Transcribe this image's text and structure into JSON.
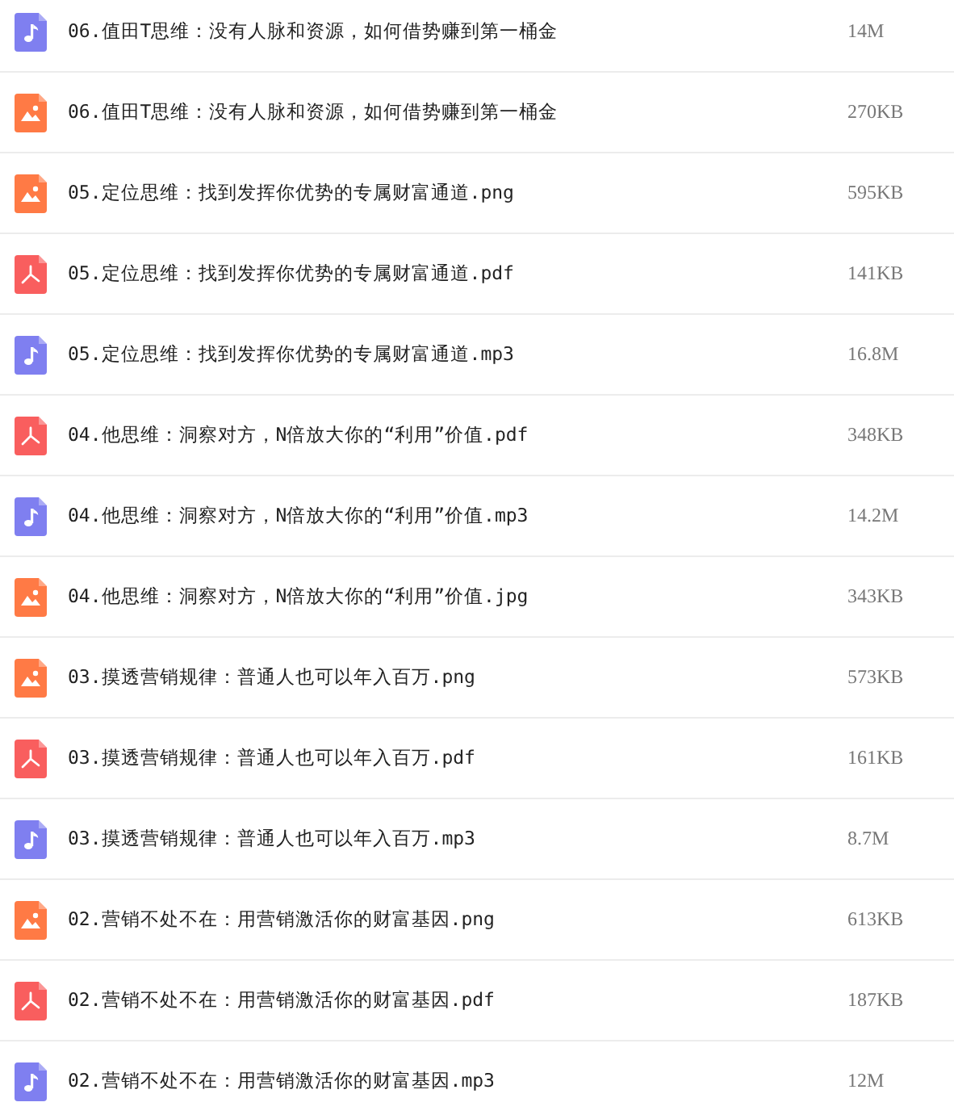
{
  "files": [
    {
      "kind": "audio",
      "name": "06.值田T思维：没有人脉和资源，如何借势赚到第一桶金",
      "size": "14M"
    },
    {
      "kind": "image",
      "name": "06.值田T思维：没有人脉和资源，如何借势赚到第一桶金",
      "size": "270KB"
    },
    {
      "kind": "image",
      "name": "05.定位思维：找到发挥你优势的专属财富通道.png",
      "size": "595KB"
    },
    {
      "kind": "pdf",
      "name": "05.定位思维：找到发挥你优势的专属财富通道.pdf",
      "size": "141KB"
    },
    {
      "kind": "audio",
      "name": "05.定位思维：找到发挥你优势的专属财富通道.mp3",
      "size": "16.8M"
    },
    {
      "kind": "pdf",
      "name": "04.他思维：洞察对方，N倍放大你的“利用”价值.pdf",
      "size": "348KB"
    },
    {
      "kind": "audio",
      "name": "04.他思维：洞察对方，N倍放大你的“利用”价值.mp3",
      "size": "14.2M"
    },
    {
      "kind": "image",
      "name": "04.他思维：洞察对方，N倍放大你的“利用”价值.jpg",
      "size": "343KB"
    },
    {
      "kind": "image",
      "name": "03.摸透营销规律：普通人也可以年入百万.png",
      "size": "573KB"
    },
    {
      "kind": "pdf",
      "name": "03.摸透营销规律：普通人也可以年入百万.pdf",
      "size": "161KB"
    },
    {
      "kind": "audio",
      "name": "03.摸透营销规律：普通人也可以年入百万.mp3",
      "size": "8.7M"
    },
    {
      "kind": "image",
      "name": "02.营销不处不在：用营销激活你的财富基因.png",
      "size": "613KB"
    },
    {
      "kind": "pdf",
      "name": "02.营销不处不在：用营销激活你的财富基因.pdf",
      "size": "187KB"
    },
    {
      "kind": "audio",
      "name": "02.营销不处不在：用营销激活你的财富基因.mp3",
      "size": "12M"
    }
  ]
}
